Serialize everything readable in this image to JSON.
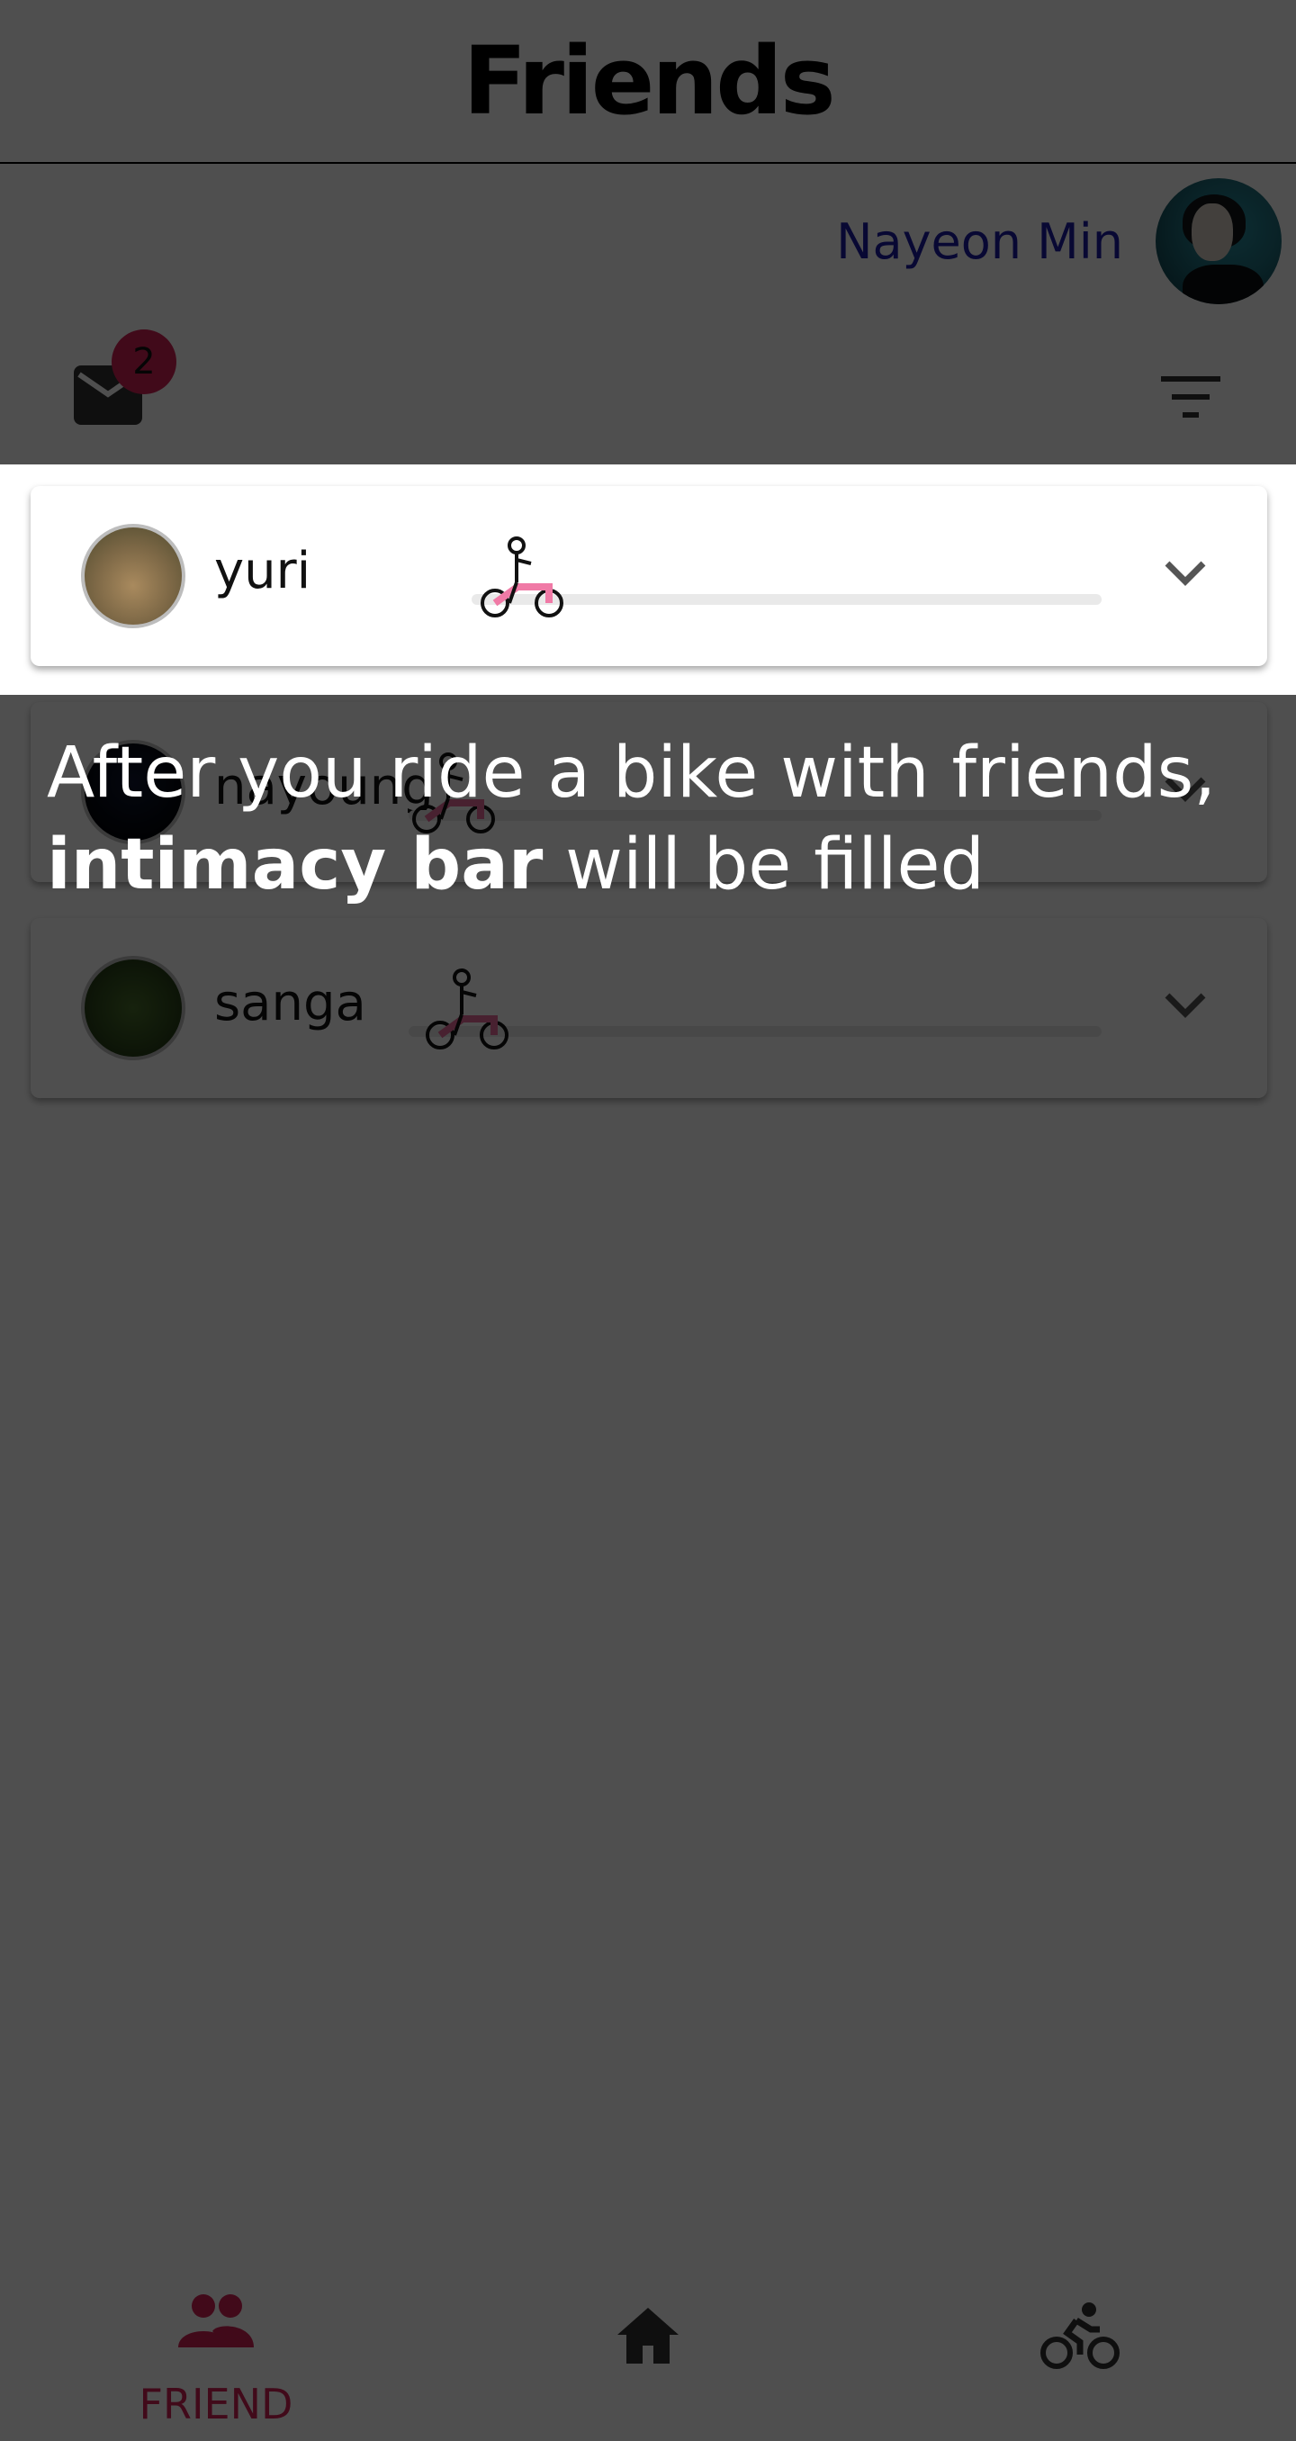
{
  "header": {
    "title": "Friends"
  },
  "profile": {
    "name": "Nayeon Min"
  },
  "toolbar": {
    "mail_badge_count": "2",
    "mail_icon": "mail-icon",
    "filter_icon": "filter-icon"
  },
  "friends": [
    {
      "name": "yuri",
      "intimacy": 0.0
    },
    {
      "name": "nayoung",
      "intimacy": 0.0
    },
    {
      "name": "sanga",
      "intimacy": 0.0
    }
  ],
  "tutorial": {
    "line1": "After you ride a bike with friends,",
    "bold": "intimacy bar",
    "rest": " will be filled"
  },
  "bottom_nav": {
    "items": [
      {
        "label": "FRIEND",
        "icon": "people-icon",
        "active": true
      },
      {
        "label": "",
        "icon": "home-icon",
        "active": false
      },
      {
        "label": "",
        "icon": "bike-icon",
        "active": false
      }
    ]
  },
  "colors": {
    "accent": "#d02054",
    "profile_name": "#1a1aa6",
    "overlay": "rgba(0,0,0,0.69)"
  }
}
